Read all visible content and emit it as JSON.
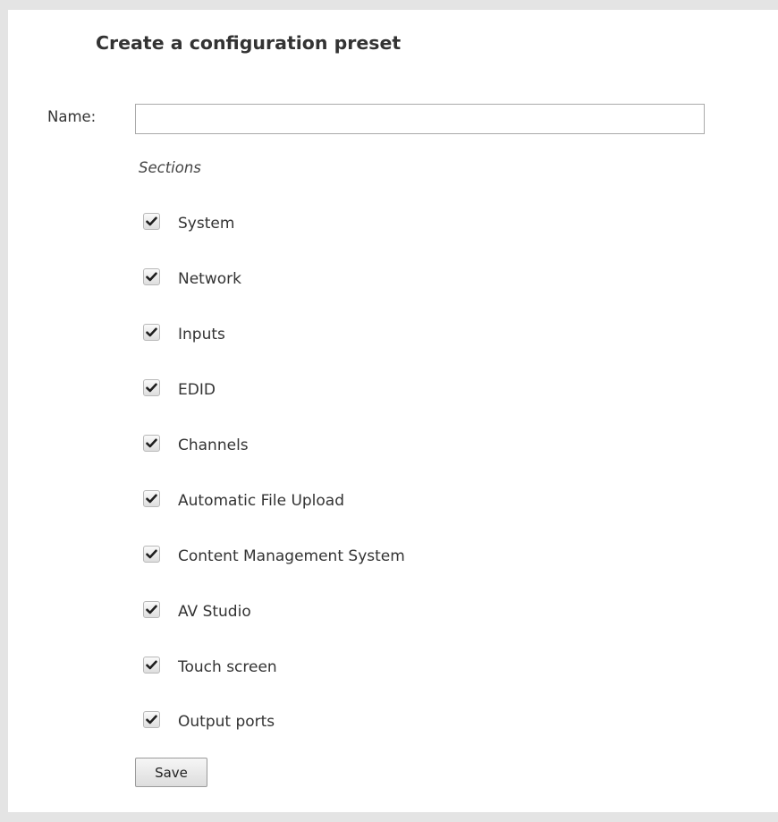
{
  "form": {
    "title": "Create a configuration preset",
    "name_label": "Name:",
    "name_value": "",
    "name_placeholder": "",
    "sections_label": "Sections",
    "sections": [
      {
        "label": "System",
        "checked": true
      },
      {
        "label": "Network",
        "checked": true
      },
      {
        "label": "Inputs",
        "checked": true
      },
      {
        "label": "EDID",
        "checked": true
      },
      {
        "label": "Channels",
        "checked": true
      },
      {
        "label": "Automatic File Upload",
        "checked": true
      },
      {
        "label": "Content Management System",
        "checked": true
      },
      {
        "label": "AV Studio",
        "checked": true
      },
      {
        "label": "Touch screen",
        "checked": true
      },
      {
        "label": "Output ports",
        "checked": true
      }
    ],
    "save_label": "Save"
  },
  "icons": {
    "checkbox": "checkmark-icon"
  },
  "colors": {
    "background": "#e4e4e4",
    "panel": "#ffffff",
    "text": "#333333",
    "checkmark": "#1f1f1f"
  }
}
